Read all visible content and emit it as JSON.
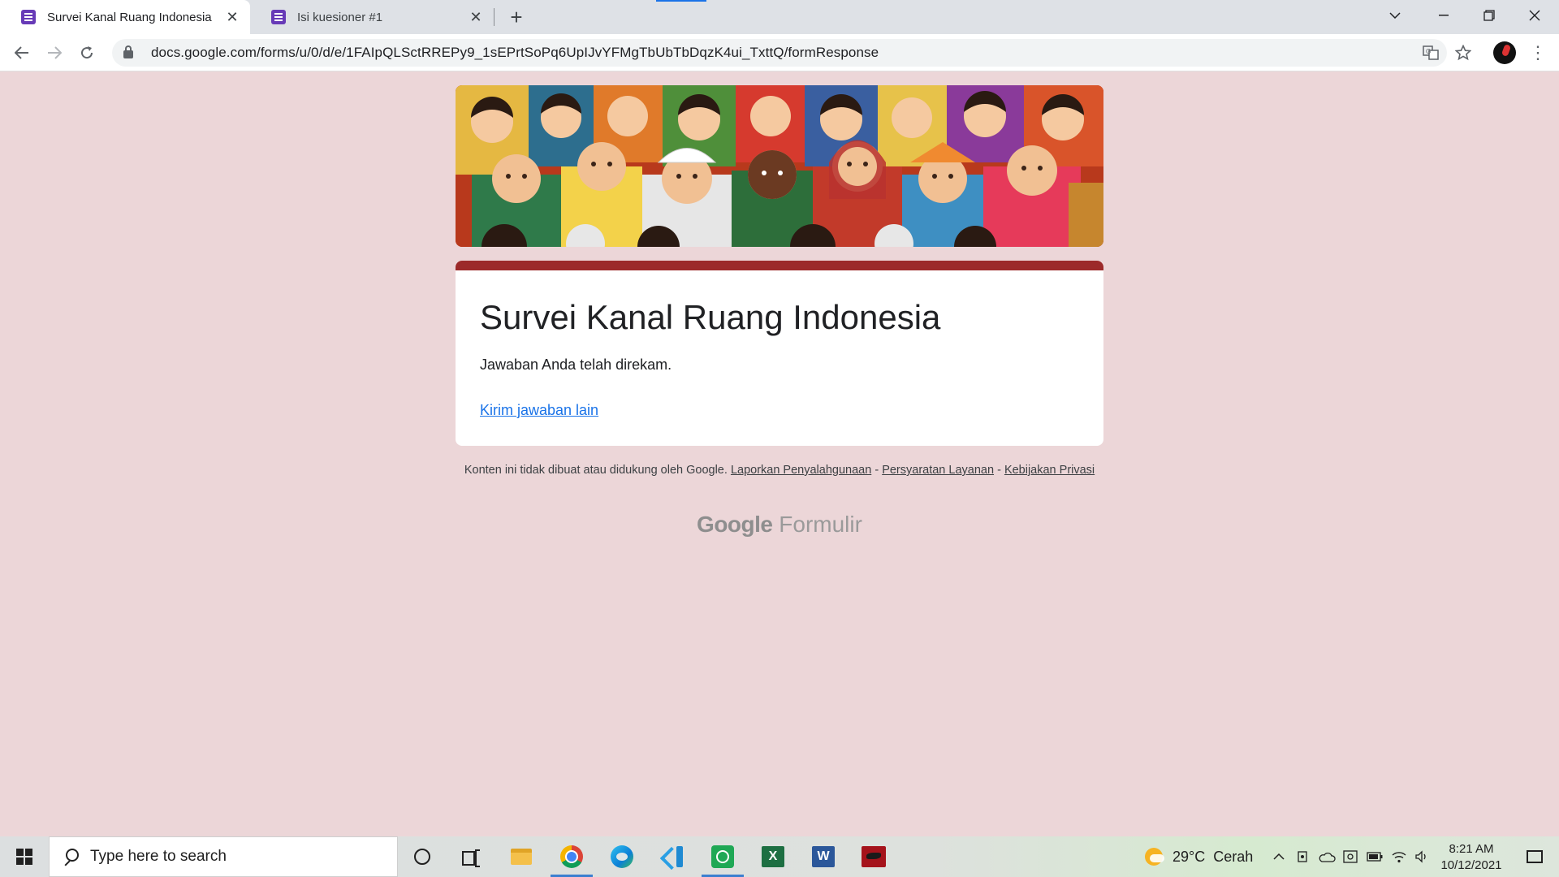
{
  "browser": {
    "tabs": [
      {
        "title": "Survei Kanal Ruang Indonesia",
        "active": true,
        "favicon": "google-forms-icon"
      },
      {
        "title": "Isi kuesioner #1",
        "active": false,
        "favicon": "google-forms-icon"
      }
    ],
    "url": "docs.google.com/forms/u/0/d/e/1FAIpQLSctRREPy9_1sEPrtSoPq6UpIJvYFMgTbUbTbDqzK4ui_TxttQ/formResponse",
    "icons": {
      "back": "arrow-left-icon",
      "forward": "arrow-right-icon",
      "reload": "reload-icon",
      "translate": "translate-icon",
      "bookmark": "star-icon",
      "menu": "kebab-menu-icon"
    }
  },
  "form": {
    "title": "Survei Kanal Ruang Indonesia",
    "confirmation": "Jawaban Anda telah direkam.",
    "submit_another": "Kirim jawaban lain",
    "accent_color": "#9c2a2a",
    "background_color": "#ecd6d8"
  },
  "footer": {
    "disclaimer": "Konten ini tidak dibuat atau didukung oleh Google.",
    "links": [
      "Laporkan Penyalahgunaan",
      "Persyaratan Layanan",
      "Kebijakan Privasi"
    ],
    "separator": "-",
    "brand_google": "Google",
    "brand_product": "Formulir"
  },
  "taskbar": {
    "search_placeholder": "Type here to search",
    "apps": [
      "cortana-icon",
      "task-view-icon",
      "file-explorer-icon",
      "chrome-icon",
      "edge-icon",
      "vscode-icon",
      "whatsapp-icon",
      "excel-icon",
      "word-icon",
      "app-icon"
    ],
    "excel_letter": "X",
    "word_letter": "W",
    "weather_temp": "29°C",
    "weather_desc": "Cerah",
    "time": "8:21 AM",
    "date": "10/12/2021"
  }
}
